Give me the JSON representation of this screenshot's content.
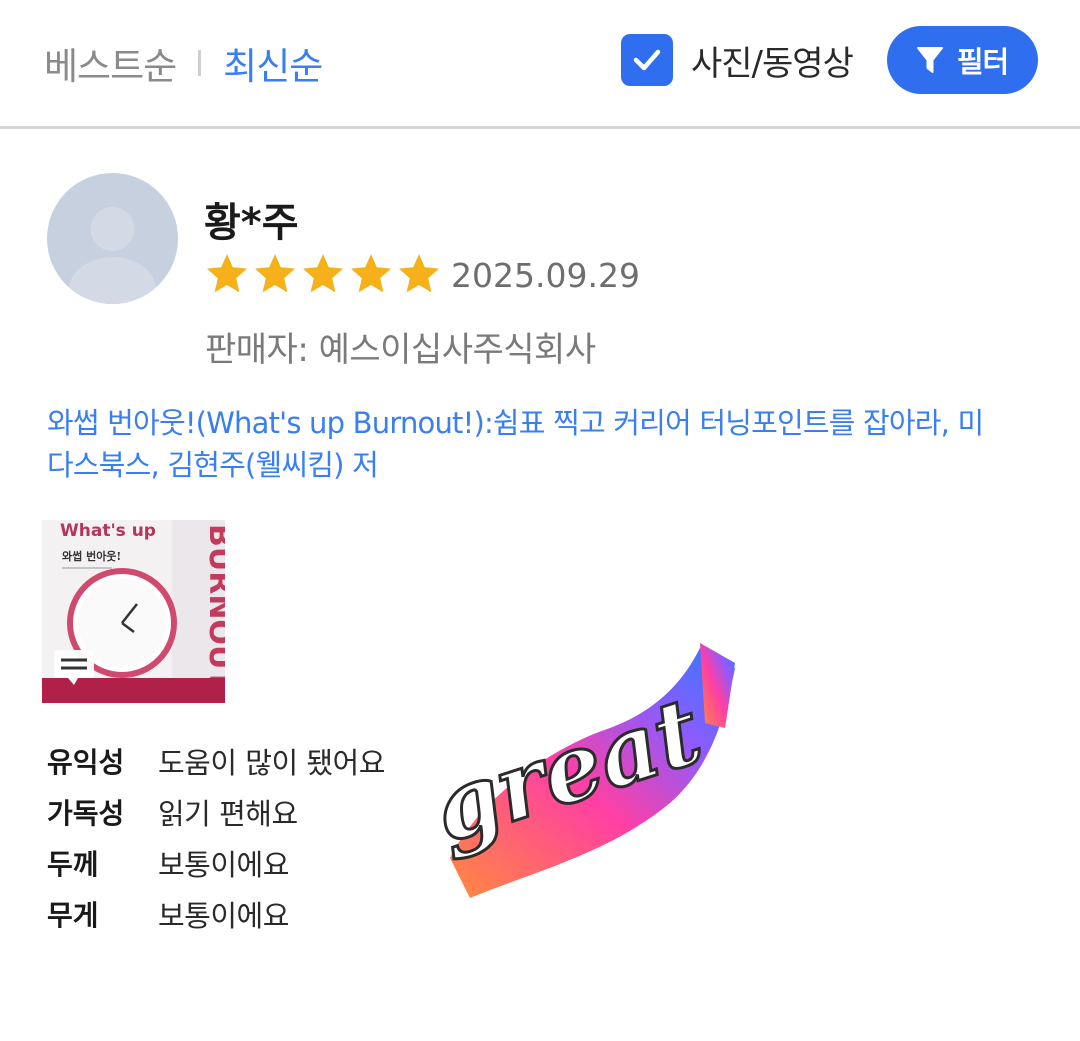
{
  "sort": {
    "best": "베스트순",
    "latest": "최신순"
  },
  "photo_filter": {
    "label": "사진/동영상",
    "checked": true
  },
  "filter_button": {
    "label": "필터"
  },
  "review": {
    "username": "황*주",
    "rating": 5,
    "date": "2025.09.29",
    "seller": "판매자: 예스이십사주식회사",
    "product_title": "와썹 번아웃!(What's up Burnout!):쉼표 찍고 커리어 터닝포인트를 잡아라, 미다스북스, 김현주(웰씨킴) 저",
    "thumbnail": {
      "title_en": "What's up",
      "title_ko": "와썹 번아웃!",
      "spine": "BURNOUT!"
    },
    "sticker_text": "great",
    "attributes": [
      {
        "key": "유익성",
        "value": "도움이 많이 됐어요"
      },
      {
        "key": "가독성",
        "value": "읽기 편해요"
      },
      {
        "key": "두께",
        "value": "보통이에요"
      },
      {
        "key": "무게",
        "value": "보통이에요"
      }
    ]
  },
  "colors": {
    "accent": "#2f6fef",
    "link": "#3a7ff1",
    "star": "#f6b01a"
  }
}
